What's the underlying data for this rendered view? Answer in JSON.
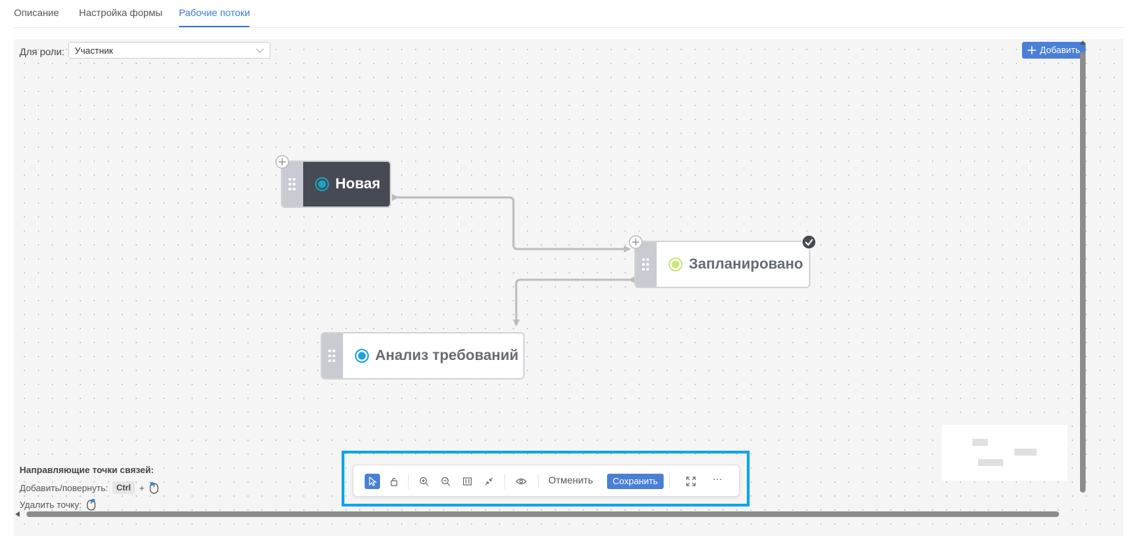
{
  "tabs": [
    {
      "label": "Описание"
    },
    {
      "label": "Настройка формы"
    },
    {
      "label": "Рабочие потоки"
    }
  ],
  "role": {
    "label": "Для роли:",
    "value": "Участник"
  },
  "add_button": {
    "label": "Добавить"
  },
  "nodes": {
    "new": {
      "title": "Новая",
      "status_color": "#1aa3c2"
    },
    "planned": {
      "title": "Запланировано",
      "status_color": "#c9e87a"
    },
    "analysis": {
      "title": "Анализ требований",
      "status_color": "#1aa3e0"
    }
  },
  "hints": {
    "title": "Направляющие точки связей:",
    "add_rotate": "Добавить/повернуть:",
    "key": "Ctrl",
    "plus": "+",
    "delete_point": "Удалить точку:"
  },
  "toolbar": {
    "cancel": "Отменить",
    "save": "Сохранить",
    "more": "···"
  },
  "colors": {
    "accent": "#4a7fd6",
    "highlight": "#0ea5e9"
  }
}
